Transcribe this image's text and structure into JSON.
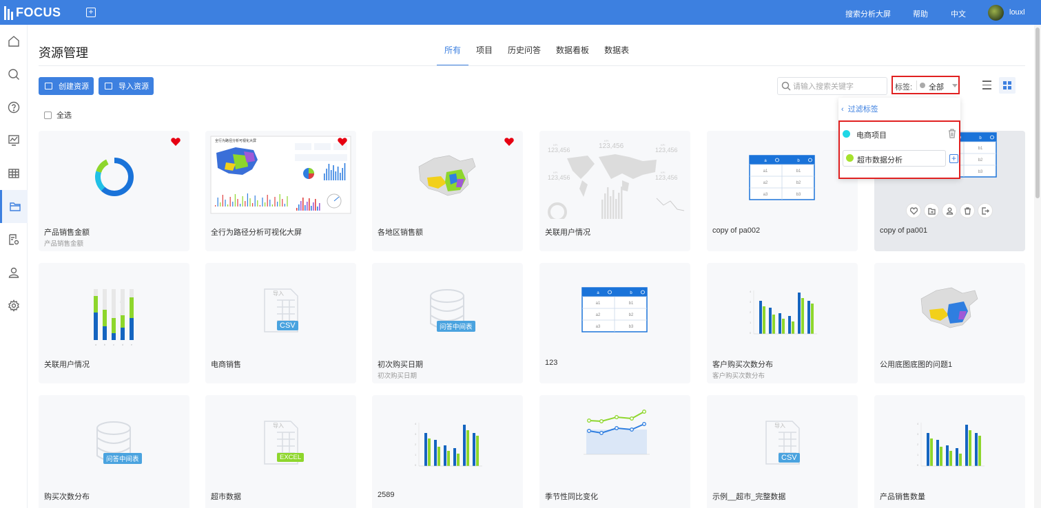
{
  "header": {
    "app_name": "FOCUS",
    "links": [
      "搜索分析大屏",
      "帮助",
      "中文"
    ],
    "user": "louxl"
  },
  "sidebar": {
    "items": [
      "home-icon",
      "search-icon",
      "help-icon",
      "chart-icon",
      "table-icon",
      "folder-icon",
      "settings-doc-icon",
      "user-icon",
      "gear-icon"
    ],
    "active": "folder-icon"
  },
  "page": {
    "title": "资源管理"
  },
  "tabs": [
    {
      "label": "所有",
      "active": true
    },
    {
      "label": "项目"
    },
    {
      "label": "历史问答"
    },
    {
      "label": "数据看板"
    },
    {
      "label": "数据表"
    }
  ],
  "toolbar": {
    "create_label": "创建资源",
    "import_label": "导入资源",
    "search_placeholder": "请输入搜索关键字",
    "tag_label": "标签:",
    "tag_value": "全部"
  },
  "select_all": "全选",
  "tag_dropdown": {
    "back_label": "过滤标签",
    "items": [
      {
        "name": "电商项目",
        "color": "#1fd7e6"
      },
      {
        "name": "超市数据分析",
        "color": "#a6e22e"
      }
    ]
  },
  "colors": {
    "accent": "#3d80e0",
    "favorite": "#e60012",
    "highlight_border": "#e02020"
  },
  "cards": [
    {
      "title": "产品销售金额",
      "subtitle": "产品销售金额",
      "thumb": "donut",
      "favorite": true
    },
    {
      "title": "全行为路径分析可视化大屏",
      "subtitle": "",
      "thumb": "dashboard",
      "favorite": true,
      "thumb_text": "全行为路径分析可视化大屏"
    },
    {
      "title": "各地区销售额",
      "subtitle": "",
      "thumb": "china-map",
      "favorite": true
    },
    {
      "title": "关联用户情况",
      "subtitle": "",
      "thumb": "world-kpi",
      "favorite": false,
      "kpi_value": "123,456",
      "kpi_label": "KPI"
    },
    {
      "title": "copy of pa002",
      "subtitle": "",
      "thumb": "table",
      "favorite": false
    },
    {
      "title": "copy of pa001",
      "subtitle": "",
      "thumb": "table",
      "favorite": false,
      "hovered": true
    },
    {
      "title": "关联用户情况",
      "subtitle": "",
      "thumb": "stacked-bar",
      "favorite": false
    },
    {
      "title": "电商销售",
      "subtitle": "",
      "thumb": "csv",
      "favorite": false,
      "badge": "CSV",
      "badge_top": "导入"
    },
    {
      "title": "初次购买日期",
      "subtitle": "初次购买日期",
      "thumb": "db",
      "favorite": false,
      "badge": "问答中间表"
    },
    {
      "title": "123",
      "subtitle": "",
      "thumb": "table",
      "favorite": false
    },
    {
      "title": "客户购买次数分布",
      "subtitle": "客户购买次数分布",
      "thumb": "bar",
      "favorite": false
    },
    {
      "title": "公用底图底图的问题1",
      "subtitle": "",
      "thumb": "china-map-blue",
      "favorite": false
    },
    {
      "title": "购买次数分布",
      "subtitle": "",
      "thumb": "db",
      "favorite": false,
      "badge": "问答中间表"
    },
    {
      "title": "超市数据",
      "subtitle": "",
      "thumb": "excel",
      "favorite": false,
      "badge": "EXCEL",
      "badge_top": "导入"
    },
    {
      "title": "2589",
      "subtitle": "",
      "thumb": "bar",
      "favorite": false
    },
    {
      "title": "季节性同比变化",
      "subtitle": "",
      "thumb": "line",
      "favorite": false
    },
    {
      "title": "示例__超市_完整数据",
      "subtitle": "",
      "thumb": "csv",
      "favorite": false,
      "badge": "CSV",
      "badge_top": "导入"
    },
    {
      "title": "产品销售数量",
      "subtitle": "",
      "thumb": "bar",
      "favorite": false
    }
  ],
  "table_thumb": {
    "headers": [
      "a",
      "b"
    ],
    "rows": [
      [
        "a1",
        "b1"
      ],
      [
        "a2",
        "b2"
      ],
      [
        "a3",
        "b3"
      ]
    ]
  }
}
